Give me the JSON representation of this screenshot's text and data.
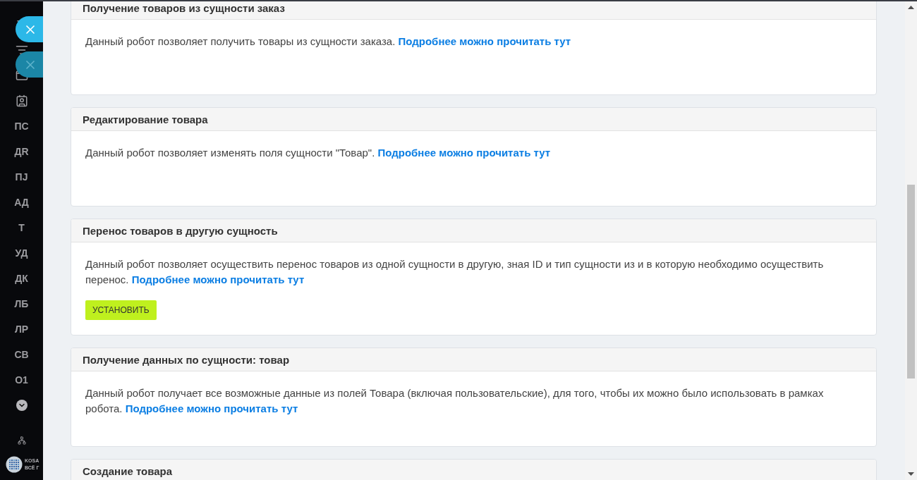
{
  "sidebar": {
    "items": [
      {
        "label": "ПС"
      },
      {
        "label": "ДR"
      },
      {
        "label": "ПJ"
      },
      {
        "label": "АД"
      },
      {
        "label": "Т"
      },
      {
        "label": "УД"
      },
      {
        "label": "ДК"
      },
      {
        "label": "ЛБ"
      },
      {
        "label": "ЛР"
      },
      {
        "label": "СВ"
      },
      {
        "label": "О1"
      }
    ],
    "profile": {
      "line_1": "KOSA",
      "line_2": "ВСЁ Г"
    }
  },
  "cards": [
    {
      "title": "Получение товаров из сущности заказ",
      "description": "Данный робот позволяет получить товары из сущности заказа.",
      "link": "Подробнее можно прочитать тут"
    },
    {
      "title": "Редактирование товара",
      "description": "Данный робот позволяет изменять поля сущности \"Товар\".",
      "link": "Подробнее можно прочитать тут"
    },
    {
      "title": "Перенос товаров в другую сущность",
      "description": "Данный робот позволяет осуществить перенос товаров из одной сущности в другую, зная ID и тип сущности из и в которую необходимо осуществить перенос.",
      "link": "Подробнее можно прочитать тут",
      "button": "УСТАНОВИТЬ"
    },
    {
      "title": "Получение данных по сущности: товар",
      "description": "Данный робот получает все возможные данные из полей Товара (включая пользовательские), для того, чтобы их можно было использовать в рамках робота.",
      "link": "Подробнее можно прочитать тут"
    },
    {
      "title": "Создание товара"
    }
  ]
}
